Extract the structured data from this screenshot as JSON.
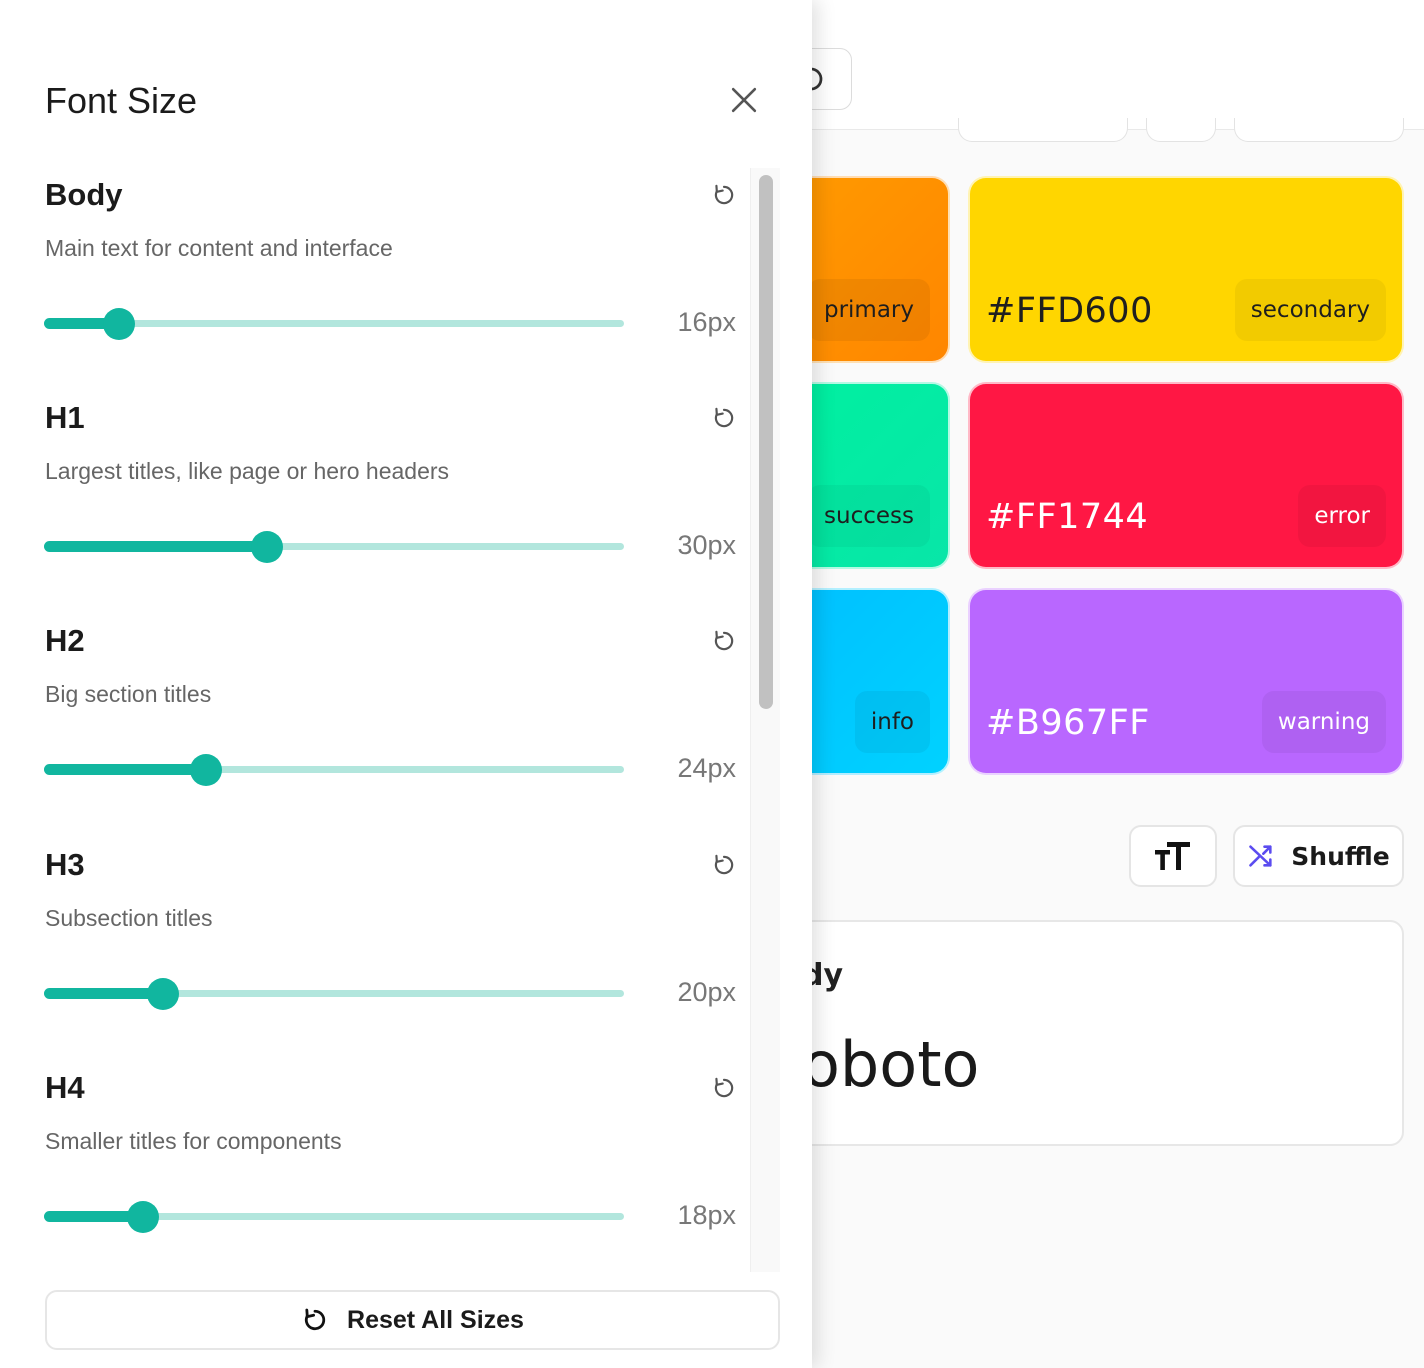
{
  "drawer": {
    "title": "Font Size",
    "reset_all_label": "Reset All Sizes",
    "sections": [
      {
        "title": "Body",
        "description": "Main text for content and interface",
        "value_label": "16px",
        "level": 0.13
      },
      {
        "title": "H1",
        "description": "Largest titles, like page or hero headers",
        "value_label": "30px",
        "level": 0.385
      },
      {
        "title": "H2",
        "description": "Big section titles",
        "value_label": "24px",
        "level": 0.28
      },
      {
        "title": "H3",
        "description": "Subsection titles",
        "value_label": "20px",
        "level": 0.205
      },
      {
        "title": "H4",
        "description": "Smaller titles for components",
        "value_label": "18px",
        "level": 0.17
      }
    ]
  },
  "palette": {
    "swatches": [
      {
        "role": "primary",
        "hex": "",
        "color": "#FF8F00"
      },
      {
        "role": "secondary",
        "hex": "#FFD600",
        "color": "#FFD600"
      },
      {
        "role": "success",
        "hex": "",
        "color": "#00E5A0"
      },
      {
        "role": "error",
        "hex": "#FF1744",
        "color": "#FF1744"
      },
      {
        "role": "info",
        "hex": "",
        "color": "#00C8FF"
      },
      {
        "role": "warning",
        "hex": "#B967FF",
        "color": "#B967FF"
      }
    ]
  },
  "toolbar": {
    "shuffle_label": "Shuffle"
  },
  "preview": {
    "heading_fragment": "dy",
    "font_fragment": "oboto"
  },
  "colors": {
    "accent": "#11B69F",
    "accent_light": "#B2E6DD",
    "shuffle_icon": "#5B4CF0"
  }
}
